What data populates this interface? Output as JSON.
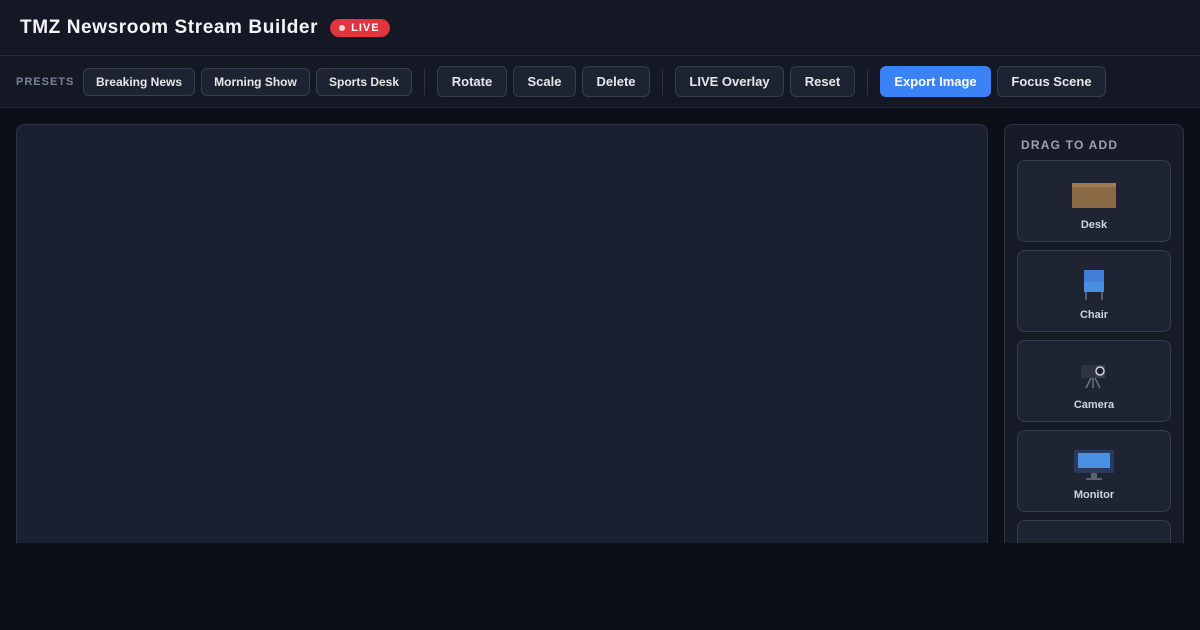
{
  "header": {
    "title": "TMZ Newsroom Stream Builder",
    "live_badge": "LIVE"
  },
  "toolbar": {
    "presets_label": "PRESETS",
    "presets": [
      "Breaking News",
      "Morning Show",
      "Sports Desk"
    ],
    "transform": [
      "Rotate",
      "Scale",
      "Delete"
    ],
    "overlay": [
      "LIVE Overlay",
      "Reset"
    ],
    "export_label": "Export Image",
    "focus_label": "Focus Scene"
  },
  "palette": {
    "title": "DRAG TO ADD",
    "items": [
      {
        "label": "Desk",
        "icon": "desk-icon"
      },
      {
        "label": "Chair",
        "icon": "chair-icon"
      },
      {
        "label": "Camera",
        "icon": "camera-icon"
      },
      {
        "label": "Monitor",
        "icon": "monitor-icon"
      },
      {
        "label": "",
        "icon": "person-icon"
      }
    ]
  },
  "colors": {
    "accent": "#3b82f6",
    "live": "#e0343f",
    "background": "#0c0f17",
    "panel": "#141824"
  }
}
